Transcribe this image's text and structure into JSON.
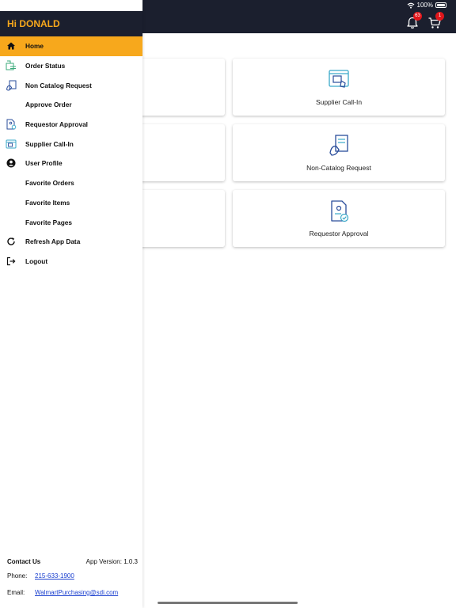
{
  "status": {
    "battery": "100%"
  },
  "header": {
    "notifications_badge": "63",
    "cart_badge": "1"
  },
  "drawer": {
    "greeting": "Hi DONALD",
    "items": [
      {
        "label": "Home",
        "icon": "home-icon",
        "active": true
      },
      {
        "label": "Order Status",
        "icon": "order-status-icon"
      },
      {
        "label": "Non Catalog Request",
        "icon": "non-catalog-icon"
      },
      {
        "label": "Approve Order",
        "icon": ""
      },
      {
        "label": "Requestor Approval",
        "icon": "requestor-approval-icon"
      },
      {
        "label": "Supplier Call-In",
        "icon": "supplier-call-in-icon"
      },
      {
        "label": "User Profile",
        "icon": "user-profile-icon"
      },
      {
        "label": "Favorite Orders",
        "icon": ""
      },
      {
        "label": "Favorite Items",
        "icon": ""
      },
      {
        "label": "Favorite Pages",
        "icon": ""
      },
      {
        "label": "Refresh App Data",
        "icon": "refresh-icon"
      },
      {
        "label": "Logout",
        "icon": "logout-icon"
      }
    ],
    "footer": {
      "contact_label": "Contact Us",
      "version": "App Version: 1.0.3",
      "phone_label": "Phone:",
      "phone": "215-633-1900",
      "email_label": "Email:",
      "email": "WalmartPurchasing@sdi.com"
    }
  },
  "tiles": [
    {
      "label": "Supplier Call-In",
      "icon": "supplier-call-in-icon"
    },
    {
      "label": "Non-Catalog Request",
      "icon": "non-catalog-icon"
    },
    {
      "label": "Requestor Approval",
      "icon": "requestor-approval-icon"
    }
  ],
  "colors": {
    "dark": "#1b1f2e",
    "accent": "#f7a81c",
    "badge": "#e0161b",
    "link": "#1a3fcf",
    "icon_blue": "#2a4d9b",
    "icon_teal": "#3aa9c9"
  }
}
